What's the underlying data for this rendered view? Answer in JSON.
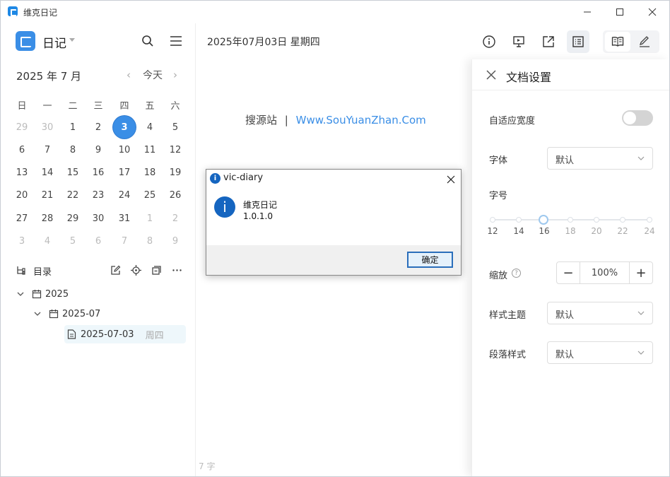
{
  "window": {
    "title": "维克日记"
  },
  "sidebar": {
    "diary_name": "日记",
    "calendar": {
      "month_label": "2025 年 7 月",
      "prev": "‹",
      "next": "›",
      "today_label": "今天",
      "weekdays": [
        "日",
        "一",
        "二",
        "三",
        "四",
        "五",
        "六"
      ],
      "weeks": [
        [
          "29",
          "30",
          "1",
          "2",
          "3",
          "4",
          "5"
        ],
        [
          "6",
          "7",
          "8",
          "9",
          "10",
          "11",
          "12"
        ],
        [
          "13",
          "14",
          "15",
          "16",
          "17",
          "18",
          "19"
        ],
        [
          "20",
          "21",
          "22",
          "23",
          "24",
          "25",
          "26"
        ],
        [
          "27",
          "28",
          "29",
          "30",
          "31",
          "1",
          "2"
        ],
        [
          "3",
          "4",
          "5",
          "6",
          "7",
          "8",
          "9"
        ]
      ],
      "selected": "3"
    },
    "toc": {
      "label": "目录",
      "year": "2025",
      "month": "2025-07",
      "entry_date": "2025-07-03",
      "entry_weekday": "周四"
    }
  },
  "document": {
    "date_title": "2025年07月03日 星期四",
    "body_prefix": "搜源站",
    "body_sep": "|",
    "body_link": "Www.SouYuanZhan.Com",
    "word_count": "7 字"
  },
  "settings_panel": {
    "title": "文档设置",
    "adaptive_width_label": "自适应宽度",
    "adaptive_width_on": false,
    "font_label": "字体",
    "font_value": "默认",
    "size_label": "字号",
    "size_ticks": [
      "12",
      "14",
      "16",
      "18",
      "20",
      "22",
      "24"
    ],
    "size_value": "16",
    "zoom_label": "缩放",
    "zoom_value": "100%",
    "zoom_minus": "−",
    "zoom_plus": "+",
    "help": "?",
    "theme_label": "样式主题",
    "theme_value": "默认",
    "paragraph_label": "段落样式",
    "paragraph_value": "默认"
  },
  "dialog": {
    "title": "vic-diary",
    "icon_glyph": "i",
    "app_name": "维克日记",
    "version": "1.0.1.0",
    "ok_label": "确定"
  },
  "colors": {
    "accent": "#3a8ee6",
    "dialog_icon": "#1565c0"
  }
}
